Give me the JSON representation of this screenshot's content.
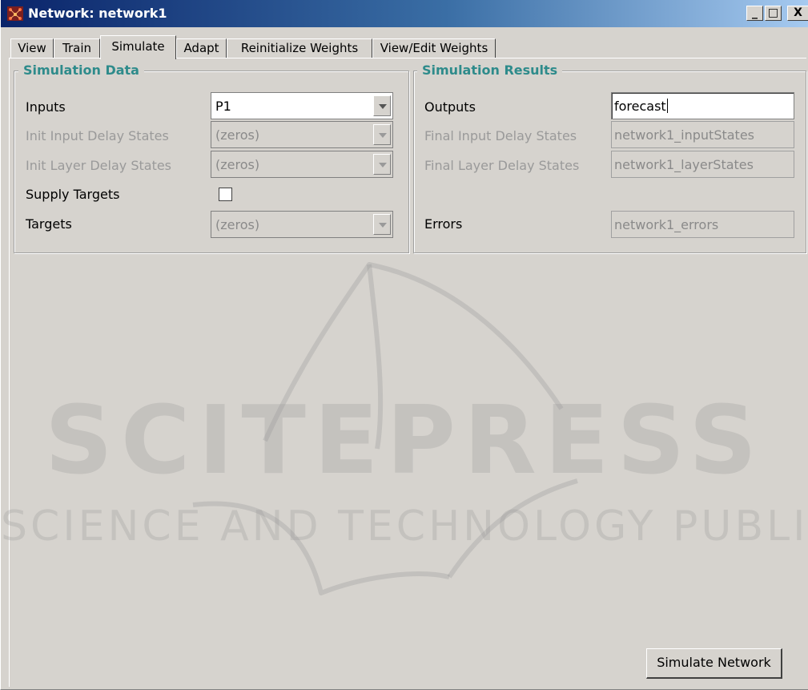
{
  "window": {
    "title": "Network: network1",
    "controls": {
      "minimize": "_",
      "maximize": "□",
      "close": "X"
    }
  },
  "tabs": [
    {
      "label": "View"
    },
    {
      "label": "Train"
    },
    {
      "label": "Simulate",
      "active": true
    },
    {
      "label": "Adapt"
    },
    {
      "label": "Reinitialize Weights"
    },
    {
      "label": "View/Edit Weights"
    }
  ],
  "simulation_data": {
    "title": "Simulation Data",
    "inputs": {
      "label": "Inputs",
      "value": "P1"
    },
    "init_input_delay": {
      "label": "Init Input Delay States",
      "value": "(zeros)"
    },
    "init_layer_delay": {
      "label": "Init Layer Delay States",
      "value": "(zeros)"
    },
    "supply_targets": {
      "label": "Supply Targets",
      "checked": false
    },
    "targets": {
      "label": "Targets",
      "value": "(zeros)"
    }
  },
  "simulation_results": {
    "title": "Simulation Results",
    "outputs": {
      "label": "Outputs",
      "value": "forecast"
    },
    "final_input_delay": {
      "label": "Final Input Delay States",
      "value": "network1_inputStates"
    },
    "final_layer_delay": {
      "label": "Final Layer Delay States",
      "value": "network1_layerStates"
    },
    "errors": {
      "label": "Errors",
      "value": "network1_errors"
    }
  },
  "actions": {
    "simulate_label": "Simulate Network"
  },
  "watermark": {
    "line1": "SCITEPRESS",
    "line2": "SCIENCE AND TECHNOLOGY PUBLICATIONS"
  },
  "colors": {
    "title_bar": "#0a246a",
    "group_title": "#2e8b8b",
    "face": "#d6d3ce"
  }
}
